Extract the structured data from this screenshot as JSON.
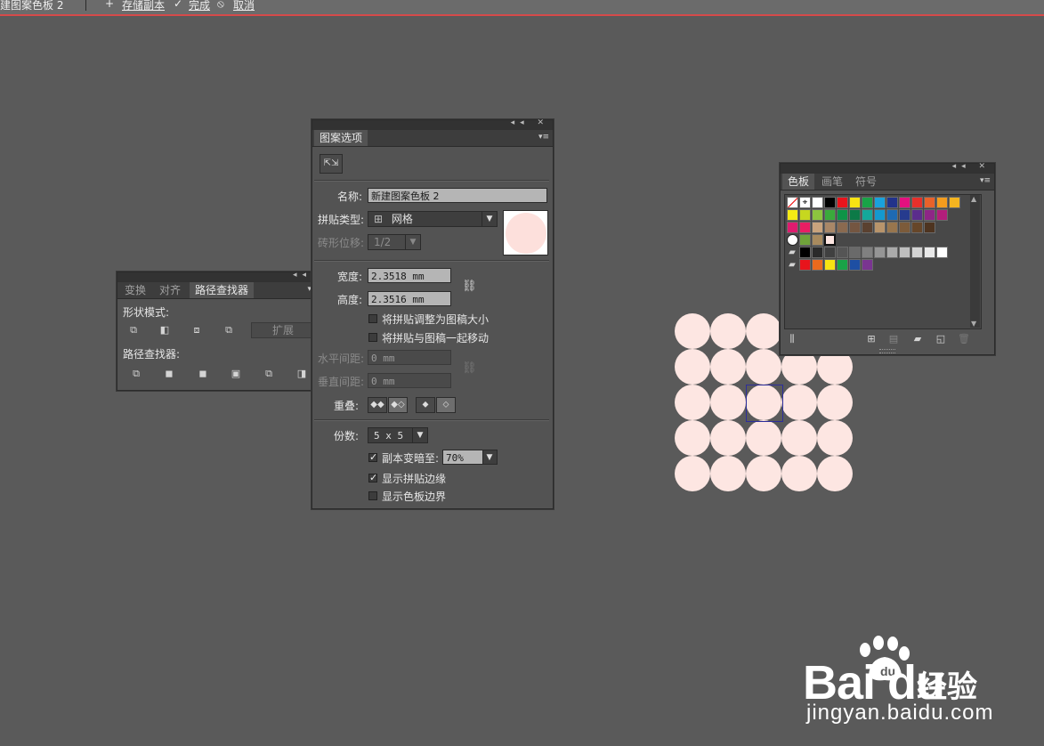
{
  "topbar": {
    "doc_name": "建图案色板 2",
    "save_copy": "存储副本",
    "done": "完成",
    "cancel": "取消"
  },
  "pathfinder_panel": {
    "tabs": [
      "变换",
      "对齐",
      "路径查找器"
    ],
    "shape_modes_label": "形状模式:",
    "expand_label": "扩展",
    "pathfinders_label": "路径查找器:"
  },
  "pattern_panel": {
    "tab": "图案选项",
    "name_label": "名称:",
    "name_value": "新建图案色板 2",
    "tile_type_label": "拼贴类型:",
    "tile_type_value": "网格",
    "brick_offset_label": "砖形位移:",
    "brick_offset_value": "1/2",
    "width_label": "宽度:",
    "width_value": "2.3518 mm",
    "height_label": "高度:",
    "height_value": "2.3516 mm",
    "opt_size_to_art": "将拼贴调整为图稿大小",
    "opt_move_with_art": "将拼贴与图稿一起移动",
    "h_spacing_label": "水平间距:",
    "h_spacing_value": "0 mm",
    "v_spacing_label": "垂直间距:",
    "v_spacing_value": "0 mm",
    "overlap_label": "重叠:",
    "copies_label": "份数:",
    "copies_value": "5 x 5",
    "dim_copies_label": "副本变暗至:",
    "dim_copies_value": "70%",
    "show_tile_edge": "显示拼贴边缘",
    "show_swatch_bounds": "显示色板边界",
    "dim_copies_checked": true,
    "show_tile_edge_checked": true,
    "show_swatch_bounds_checked": false
  },
  "swatches_panel": {
    "tabs": [
      "色板",
      "画笔",
      "符号"
    ],
    "rows": [
      [
        "#ffffff",
        "#000000",
        "#e8141c",
        "#f7e313",
        "#19a347",
        "#1aa1dc",
        "#22338b",
        "#e4117f",
        "#e6302b",
        "#e9622a",
        "#f39c1e",
        "#f4b420"
      ],
      [
        "#f4ea15",
        "#c6d71f",
        "#8cc43f",
        "#3aaa3b",
        "#0e9447",
        "#0c7a47",
        "#15a89a",
        "#1499cf",
        "#1e6ab3",
        "#263b8e",
        "#5b2d8c",
        "#8e2687",
        "#b21e7b"
      ],
      [
        "#de1c6f",
        "#e91e63",
        "#c9a37d",
        "#a98767",
        "#8a6a50",
        "#745641",
        "#5a4130",
        "#b8946b",
        "#98764e",
        "#7c5b3a",
        "#664629",
        "#4e3420"
      ],
      [
        "#000000",
        "#2a2a2a",
        "#404040",
        "#555555",
        "#6a6a6a",
        "#808080",
        "#959595",
        "#aaaaaa",
        "#bfbfbf",
        "#d4d4d4",
        "#e9e9e9",
        "#ffffff"
      ],
      [
        "#e8141c",
        "#ea6a1d",
        "#f7e313",
        "#19a347",
        "#1e4fa3",
        "#7a3591"
      ]
    ],
    "colors": {
      "tile_fill": "#fde6e2",
      "tile_border": "#2d2d9b",
      "accent_red": "#d64a4a"
    }
  },
  "watermark": {
    "logo": "Bai du",
    "logo_cn": "经验",
    "url": "jingyan.baidu.com"
  }
}
